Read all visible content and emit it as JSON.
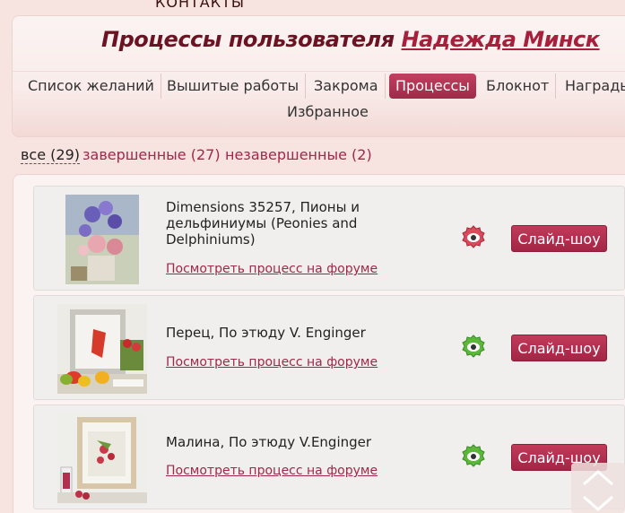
{
  "topnav": {
    "contacts_label": "КОНТАКТЫ"
  },
  "header": {
    "title_prefix": "Процессы пользователя",
    "user_name": "Надежда Минск"
  },
  "tabs": [
    {
      "label": "Список желаний"
    },
    {
      "label": "Вышитые работы"
    },
    {
      "label": "Закрома"
    },
    {
      "label": "Процессы",
      "active": true
    },
    {
      "label": "Блокнот"
    },
    {
      "label": "Награды"
    },
    {
      "label": "Избранное"
    }
  ],
  "filters": {
    "all": "все (29)",
    "done": "завершенные (27)",
    "undone": "незавершенные (2)"
  },
  "items": [
    {
      "title": "Dimensions 35257, Пионы и дельфиниумы (Peonies and Delphiniums)",
      "link": "Посмотреть процесс на форуме",
      "status_icon": "gear-red-icon",
      "button": "Слайд-шоу"
    },
    {
      "title": "Перец, По этюду V. Enginger",
      "link": "Посмотреть процесс на форуме",
      "status_icon": "gear-green-icon",
      "button": "Слайд-шоу"
    },
    {
      "title": "Малина, По этюду V.Enginger",
      "link": "Посмотреть процесс на форуме",
      "status_icon": "gear-green-icon",
      "button": "Слайд-шоу"
    }
  ],
  "colors": {
    "accent": "#a0284a",
    "title": "#6b1322",
    "button": "#b0304f",
    "gear_red": "#d94a5a",
    "gear_green": "#5cb83a"
  }
}
